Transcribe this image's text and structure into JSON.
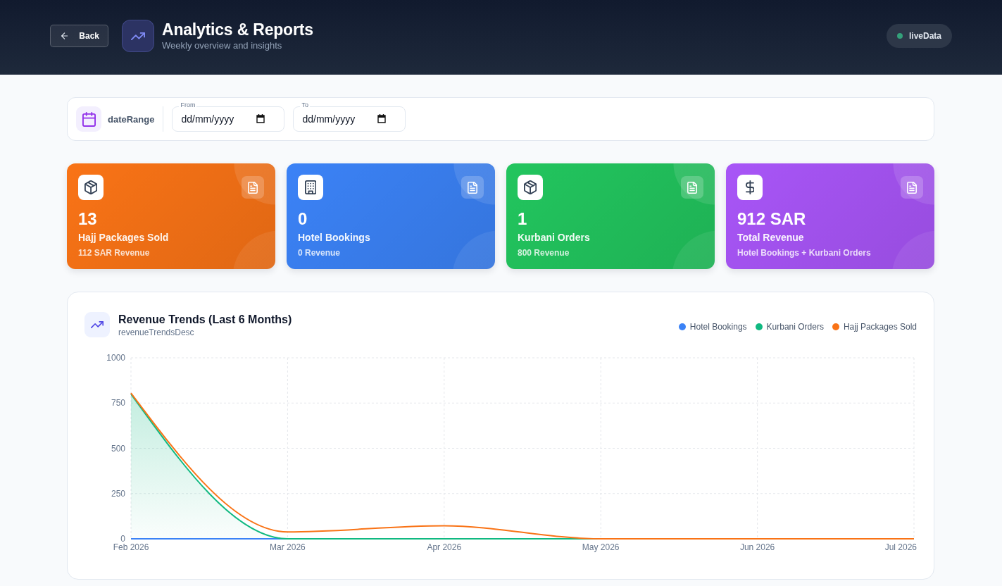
{
  "header": {
    "back_button": "Back",
    "title": "Analytics & Reports",
    "subtitle": "Weekly overview and insights",
    "status": "liveData"
  },
  "date_range": {
    "label": "dateRange",
    "fields": [
      {
        "label": "From",
        "placeholder": "dd/mm/yyyy"
      },
      {
        "label": "To",
        "placeholder": "dd/mm/yyyy"
      }
    ]
  },
  "stat_cards": [
    {
      "kind": "product",
      "value": "13",
      "label": "Hajj Packages Sold",
      "detail": "112 SAR Revenue",
      "color": "#f97316"
    },
    {
      "kind": "lodging",
      "value": "0",
      "label": "Hotel Bookings",
      "detail": "0 Revenue",
      "color": "#3b82f6"
    },
    {
      "kind": "product",
      "value": "1",
      "label": "Kurbani Orders",
      "detail": "800 Revenue",
      "color": "#22c55e"
    },
    {
      "kind": "total",
      "value": "912 SAR",
      "label": "Total Revenue",
      "detail": "Hotel Bookings + Kurbani Orders",
      "color": "#a855f7"
    }
  ],
  "revenue_chart": {
    "title": "Revenue Trends (Last 6 Months)",
    "subtitle": "revenueTrendsDesc",
    "chart_data": {
      "type": "line",
      "categories": [
        "Feb 2026",
        "Mar 2026",
        "Apr 2026",
        "May 2026",
        "Jun 2026",
        "Jul 2026"
      ],
      "series": [
        {
          "name": "Hotel Bookings",
          "type": "line",
          "color": "#3b82f6",
          "values": [
            0,
            0,
            null,
            null,
            null,
            null
          ]
        },
        {
          "name": "Kurbani Orders",
          "type": "area",
          "color": "#10b981",
          "values": [
            800,
            0,
            0,
            0,
            0,
            0
          ]
        },
        {
          "name": "Hajj Packages Sold",
          "type": "line",
          "color": "#f97316",
          "values": [
            805,
            38,
            72,
            0,
            0,
            0
          ]
        }
      ],
      "ylim": [
        0,
        1000
      ],
      "yticks": [
        0,
        250,
        500,
        750,
        1000
      ],
      "grid": true
    }
  }
}
